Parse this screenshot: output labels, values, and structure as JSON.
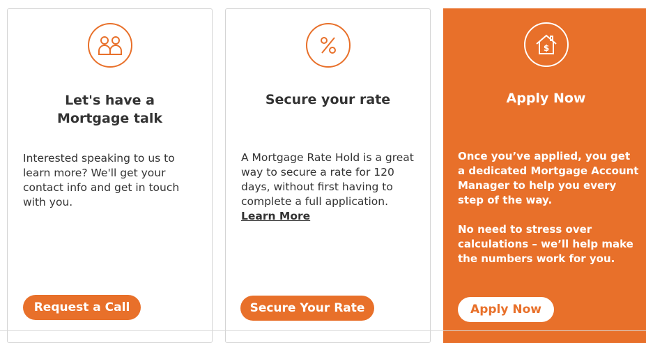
{
  "colors": {
    "accent": "#e8702a",
    "text": "#333333",
    "card_border": "#d4d4d4"
  },
  "cards": [
    {
      "icon": "people-icon",
      "title_line1": "Let's have a",
      "title_line2": "Mortgage talk",
      "body": "Interested speaking to us to learn more? We'll get your contact info and get in touch with you.",
      "button": "Request a Call"
    },
    {
      "icon": "percent-icon",
      "title": "Secure your rate",
      "body": "A Mortgage Rate Hold is a great way to secure a rate for 120 days, without first having to complete a full application.",
      "link": "Learn More",
      "button": "Secure Your Rate"
    },
    {
      "icon": "house-dollar-icon",
      "title": "Apply Now",
      "body_p1": "Once you’ve applied, you get a dedicated Mortgage Account Manager to help you every step of the way.",
      "body_p2": "No need to stress over calculations – we’ll help make the numbers work for you.",
      "button": "Apply Now"
    }
  ]
}
